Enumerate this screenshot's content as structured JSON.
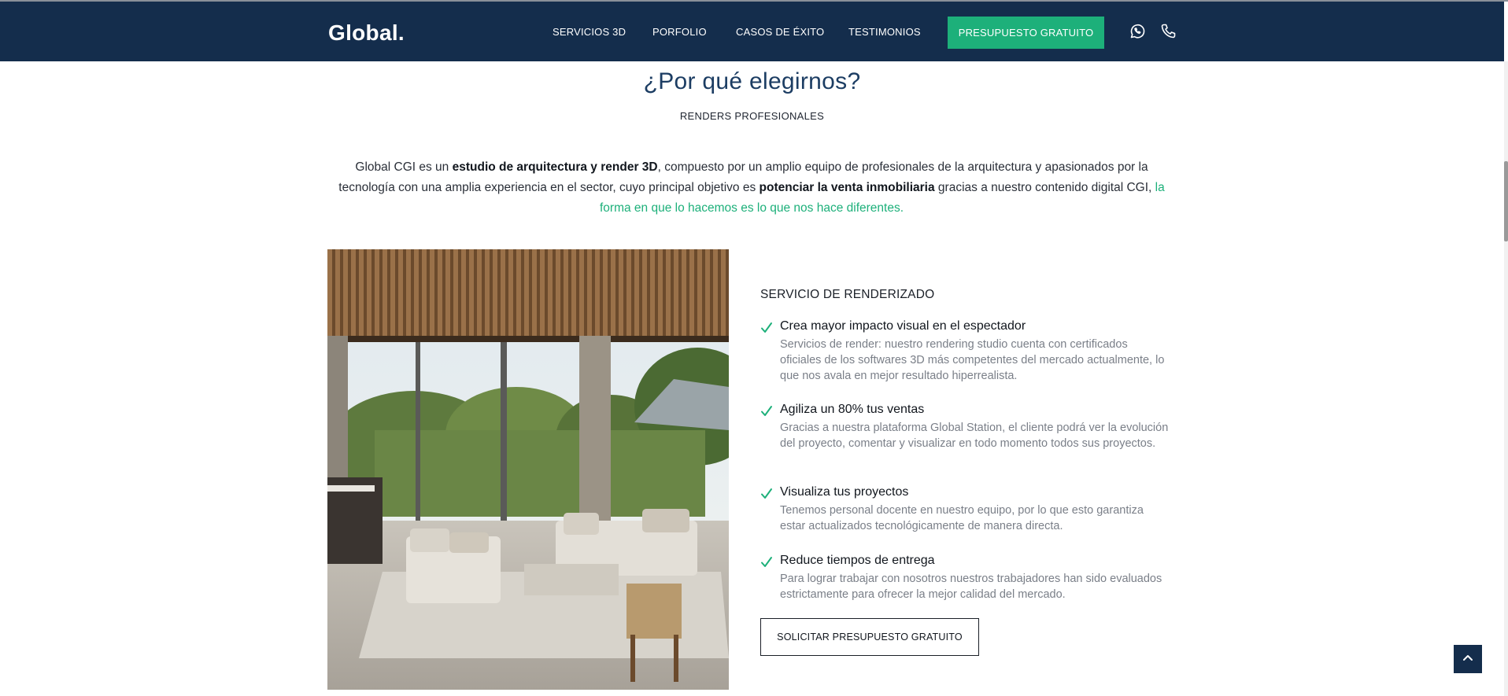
{
  "header": {
    "logo": "Global.",
    "nav": [
      "SERVICIOS 3D",
      "PORFOLIO",
      "CASOS DE ÉXITO",
      "TESTIMONIOS"
    ],
    "cta": "PRESUPUESTO GRATUITO",
    "icons": [
      "whatsapp-icon",
      "phone-icon"
    ]
  },
  "section": {
    "title": "¿Por qué elegirnos?",
    "subtitle": "RENDERS PROFESIONALES",
    "intro": {
      "t1": "Global CGI es un ",
      "b1": "estudio de arquitectura y render 3D",
      "t2": ", compuesto por un amplio equipo de profesionales de la arquitectura y apasionados por la tecnología con una amplia experiencia en el sector, cuyo principal objetivo es ",
      "b2": "potenciar la venta inmobiliaria",
      "t3": " gracias a nuestro contenido digital CGI, ",
      "link": "la forma en que lo hacemos es lo que nos hace diferentes."
    }
  },
  "services": {
    "title": "SERVICIO DE RENDERIZADO",
    "features": [
      {
        "title": "Crea mayor impacto visual en el espectador",
        "desc": "Servicios de render: nuestro rendering studio cuenta con certificados oficiales de los softwares 3D más competentes del mercado actualmente, lo que nos avala en mejor resultado hiperrealista."
      },
      {
        "title": "Agiliza un 80% tus ventas",
        "desc": "Gracias a nuestra plataforma Global Station, el cliente podrá ver la evolución del proyecto, comentar y visualizar en todo momento todos sus proyectos."
      },
      {
        "title": "Visualiza tus proyectos",
        "desc": "Tenemos personal docente en nuestro equipo, por lo que esto garantiza estar actualizados tecnológicamente de manera directa."
      },
      {
        "title": "Reduce tiempos de entrega",
        "desc": "Para lograr trabajar con nosotros nuestros trabajadores han sido evaluados estrictamente para ofrecer la mejor calidad del mercado."
      }
    ],
    "button": "SOLICITAR PRESUPUESTO GRATUITO"
  },
  "colors": {
    "header_bg": "#142d4c",
    "accent": "#1db07a",
    "title": "#1c3d63"
  }
}
